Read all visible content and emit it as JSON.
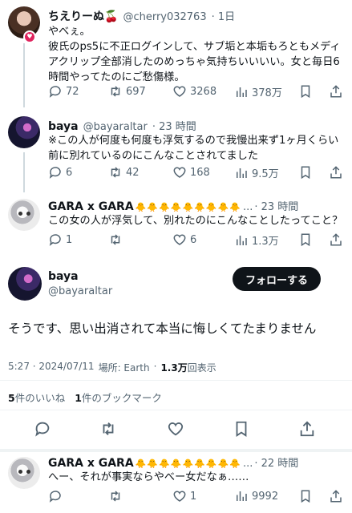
{
  "post1": {
    "display_name": "ちえりーぬ🍒",
    "handle": "@cherry032763",
    "time": "· 1日",
    "text": "やべぇ。\n彼氏のps5に不正ログインして、サブ垢と本垢もろともメディアクリップ全部消したのめっちゃ気持ちいいいい。女と毎日6時間やってたのにご愁傷様。",
    "replies": "72",
    "reposts": "697",
    "likes": "3268",
    "views": "378万"
  },
  "post2": {
    "display_name": "baya",
    "handle": "@bayaraltar",
    "time": "· 23 時間",
    "text": "※この人が何度も何度も浮気するので我慢出来ず1ヶ月くらい前に別れているのにこんなことされてました",
    "replies": "6",
    "reposts": "42",
    "likes": "168",
    "views": "9.5万"
  },
  "post3": {
    "display_name": "GARA x GARA",
    "emojis": "🐥🐥🐥🐥🐥🐥🐥🐥🐥",
    "handle": "...",
    "time": "· 23 時間",
    "text": "この女の人が浮気して、別れたのにこんなことしたってこと？",
    "replies": "1",
    "reposts": "",
    "likes": "6",
    "views": "1.3万"
  },
  "main": {
    "display_name": "baya",
    "handle": "@bayaraltar",
    "follow_label": "フォローする",
    "text": "そうです、思い出消されて本当に悔しくてたまりません",
    "meta_time": "5:27 · 2024/07/11",
    "meta_location": "場所: Earth",
    "meta_views_count": "1.3万",
    "meta_views_label": "回表示",
    "likes_count": "5",
    "likes_label": "件のいいね",
    "bookmarks_count": "1",
    "bookmarks_label": "件のブックマーク"
  },
  "post4": {
    "display_name": "GARA x GARA",
    "emojis": "🐥🐥🐥🐥🐥🐥🐥🐥🐥",
    "handle": "...",
    "time": "· 22 時間",
    "text": "へー、それが事実ならやべー女だなぁ……",
    "replies": "",
    "reposts": "",
    "likes": "1",
    "views": "9992"
  },
  "icons": [
    "reply-icon",
    "repost-icon",
    "like-icon",
    "views-icon",
    "bookmark-icon",
    "share-icon"
  ],
  "colors": {
    "text": "#0f1419",
    "muted": "#536471",
    "divider": "#eff3f4",
    "follow_bg": "#0f1419"
  }
}
